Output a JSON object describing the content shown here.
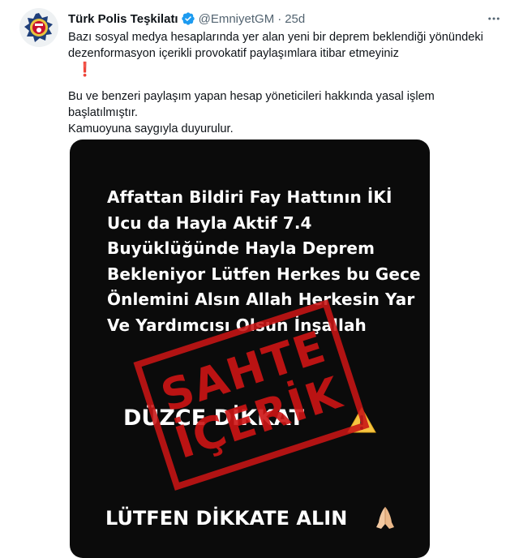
{
  "tweet": {
    "display_name": "Türk Polis Teşkilatı",
    "handle": "@EmniyetGM",
    "separator": "·",
    "time": "25d",
    "text_line1": "Bazı sosyal medya hesaplarında yer alan yeni bir deprem beklendiği yönündeki dezenformasyon içerikli provokatif paylaşımlara itibar etmeyiniz",
    "exclamation": "❗",
    "text_line2": "Bu ve benzeri paylaşım yapan hesap yöneticileri hakkında yasal işlem başlatılmıştır.",
    "text_line3": "Kamuoyuna saygıyla duyurulur."
  },
  "media": {
    "lines": [
      "Affattan Bildiri Fay Hattının İKİ",
      "Ucu da Hayla Aktif 7.4",
      "Buyüklüğünde Hayla Deprem",
      "Bekleniyor Lütfen Herkes bu Gece",
      "Önlemini Alsın Allah Herkesin Yar",
      "Ve Yardımcısı Olsun İnşallah"
    ],
    "duzce": "DÜZCE DİKKAT",
    "dikkat": "LÜTFEN DİKKATE ALIN",
    "stamp_word1": "SAHTE",
    "stamp_word2": "İÇERİK"
  },
  "icons": {
    "avatar": "police-badge-icon",
    "verified": "verified-badge-icon",
    "more": "more-options-icon",
    "warning": "warning-icon",
    "pray": "praying-hands-icon"
  },
  "colors": {
    "verified": "#1d9bf0",
    "stamp": "#c81414",
    "secondary_text": "#536471"
  }
}
